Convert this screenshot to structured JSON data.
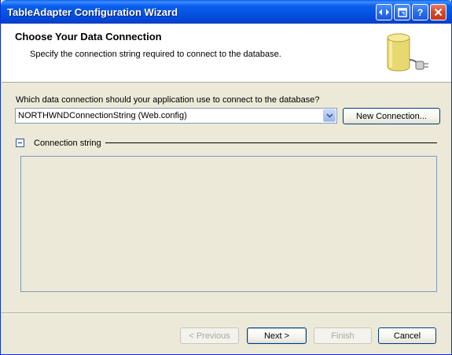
{
  "window": {
    "title": "TableAdapter Configuration Wizard"
  },
  "header": {
    "title": "Choose Your Data Connection",
    "subtitle": "Specify the connection string required to connect to the database.",
    "icon": "database-plug-icon"
  },
  "connection": {
    "question": "Which data connection should your application use to connect to the database?",
    "selected": "NORTHWNDConnectionString (Web.config)",
    "new_connection_label": "New Connection..."
  },
  "connection_string": {
    "label": "Connection string",
    "value": ""
  },
  "footer": {
    "previous_label": "< Previous",
    "next_label": "Next >",
    "finish_label": "Finish",
    "cancel_label": "Cancel"
  },
  "colors": {
    "titlebar": "#0554e3",
    "face": "#ece9d8",
    "header_bg": "#ffffff"
  }
}
